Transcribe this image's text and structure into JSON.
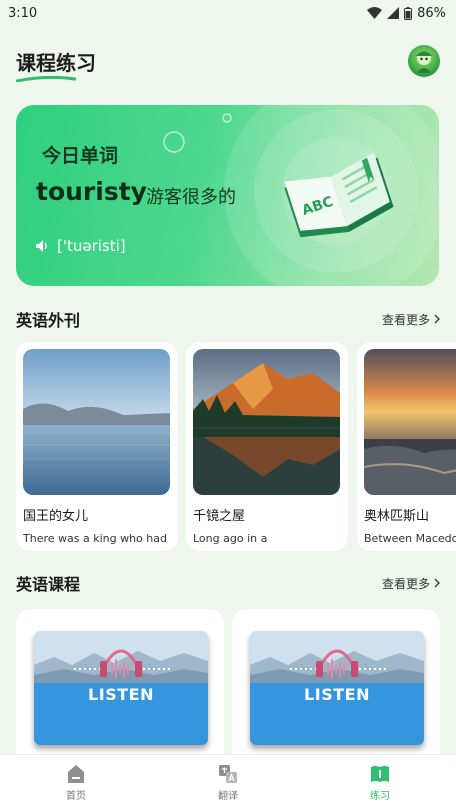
{
  "status_bar": {
    "time": "3:10",
    "battery": "86%"
  },
  "header": {
    "title": "课程练习"
  },
  "word_card": {
    "label": "今日单词",
    "word": "touristy",
    "meaning": "游客很多的",
    "phonetic": "['tuəristi]",
    "book_text": "ABC"
  },
  "journal_section": {
    "title": "英语外刊",
    "more": "查看更多",
    "items": [
      {
        "title": "国王的女儿",
        "subtitle": "There was a king who had"
      },
      {
        "title": "千镜之屋",
        "subtitle": "Long ago in a"
      },
      {
        "title": "奥林匹斯山",
        "subtitle": "Between Macedonia"
      }
    ]
  },
  "course_section": {
    "title": "英语课程",
    "more": "查看更多",
    "items": [
      {
        "label": "LISTEN"
      },
      {
        "label": "LISTEN"
      }
    ]
  },
  "bottom_nav": {
    "items": [
      {
        "label": "首页",
        "active": false
      },
      {
        "label": "翻译",
        "active": false
      },
      {
        "label": "练习",
        "active": true
      }
    ]
  },
  "colors": {
    "accent": "#2fbf6f",
    "background": "#eef6ee"
  }
}
